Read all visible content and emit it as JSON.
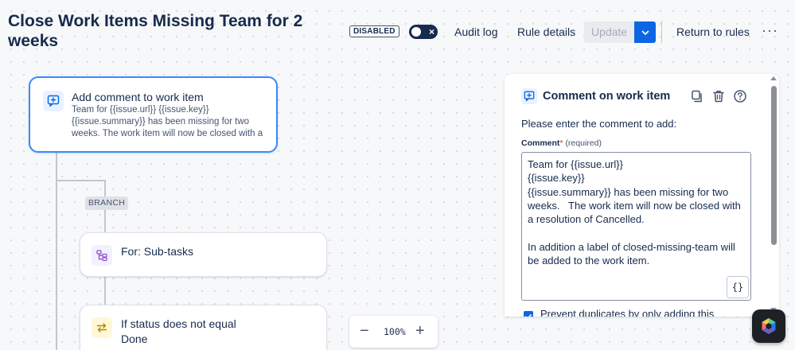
{
  "header": {
    "title": "Close Work Items Missing Team for 2 weeks",
    "status_badge": "DISABLED",
    "toggle_icon": "×",
    "audit_log": "Audit log",
    "rule_details": "Rule details",
    "update": "Update",
    "return_to_rules": "Return to rules",
    "more": "···"
  },
  "flow": {
    "nodes": [
      {
        "title": "Add comment to work item",
        "description": "Team for {{issue.url}} {{issue.key}} {{issue.summary}} has been missing for two weeks. The work item will now be closed with a resolution of Cancelled. In addition a label of closed-missing-team will be added to the work item.",
        "icon": "comment-add-icon"
      },
      {
        "title": "For: Sub-tasks",
        "icon": "subtasks-branch-icon"
      },
      {
        "title": "If status does not equal",
        "subtitle": "Done",
        "icon": "condition-swap-icon"
      }
    ],
    "branch_label": "BRANCH"
  },
  "zoom": {
    "minus": "−",
    "value": "100%",
    "plus": "+"
  },
  "panel": {
    "title": "Comment on work item",
    "prompt": "Please enter the comment to add:",
    "field_label": "Comment",
    "required_mark": "*",
    "required_text": "(required)",
    "comment_value": "Team for {{issue.url}}\n{{issue.key}}\n{{issue.summary}} has been missing for two weeks.   The work item will now be closed with a resolution of Cancelled.\n\nIn addition a label of closed-missing-team will be added to the work item.",
    "smart_values_button": "{}",
    "checkbox_label": "Prevent duplicates by only adding this"
  },
  "colors": {
    "accent": "#0c66e4",
    "selected_border": "#388bff",
    "text": "#172b4d",
    "canvas": "#f7f8f9"
  }
}
